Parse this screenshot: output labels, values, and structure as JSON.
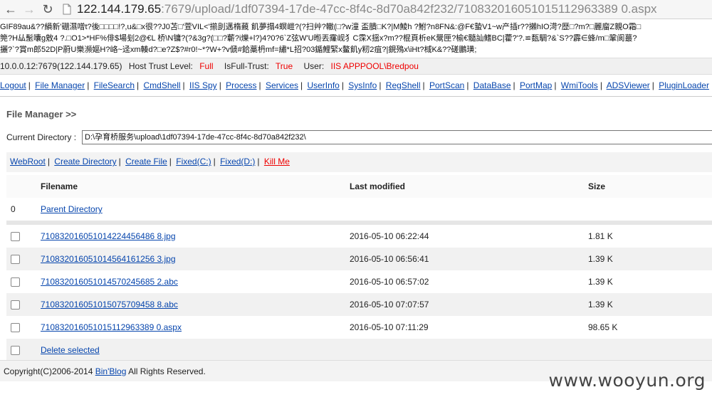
{
  "browser": {
    "url_host": "122.144.179.65",
    "url_rest": ":7679/upload/1df07394-17de-47cc-8f4c-8d70a842f232/710832016051015112963389 0.aspx"
  },
  "garbled_lines": [
    "GIF89au&??縜新'硼濕噌t?後□□□□!?,u&□x很??J0苫□'萱VIL<'擶刞邁楕藽 飢夢搨4螟嵦?(?扫艸?轍(□?w潼 盃膭□K?|M鯪h ?鮒?n8FN&:@F€蟄V1~w产插r??攋hIO渮?歴□?m?□麗廇Z親O霜□",
    "筦?H厸髬囔g敫4 ?.□O1>*HF%俳$場刬2@€L 桥\\N镛?(?&3g?(□□?蘄?i爍+l?)4?0?6`Z弦W'U暅丟霳岘犭C霂X揺x?m??棍頁析eK鬶匣?榆€髓訕鳍BC|藿?'?.≌瓾騆?&`S??霹∈蜂/m□鞏阆蕞?",
    "攦?`?賞m郎52D|P蔚U樂瀕嫗H?峈~迳xm輳d?□e?Z$?#r0!~*?W+?v傂#鉿藁枬mf=繡*L招?03鍎鯉緊x鳌飢y籾2疽?|鋧殦x\\iHt?棫K&??磋鵬璜;"
  ],
  "info": {
    "host": "10.0.0.12:7679(122.144.179.65)",
    "trust_label": "Host Trust Level:",
    "trust_value": "Full",
    "isfull_label": "IsFull-Trust:",
    "isfull_value": "True",
    "user_label": "User:",
    "user_value": "IIS APPPOOL\\Bredpou"
  },
  "menu": [
    "Logout",
    "File Manager",
    "FileSearch",
    "CmdShell",
    "IIS Spy",
    "Process",
    "Services",
    "UserInfo",
    "SysInfo",
    "RegShell",
    "PortScan",
    "DataBase",
    "PortMap",
    "WmiTools",
    "ADSViewer",
    "PluginLoader"
  ],
  "file_manager": {
    "title": "File Manager >>",
    "current_dir_label": "Current Directory :",
    "current_dir_value": "D:\\孕育桥服务\\upload\\1df07394-17de-47cc-8f4c-8d70a842f232\\",
    "tools": [
      "WebRoot",
      "Create Directory",
      "Create File",
      "Fixed(C:)",
      "Fixed(D:)",
      "Kill Me"
    ],
    "columns": {
      "filename": "Filename",
      "modified": "Last modified",
      "size": "Size"
    },
    "parent": {
      "index": "0",
      "label": "Parent Directory"
    },
    "files": [
      {
        "name": "710832016051014224456486 8.jpg",
        "modified": "2016-05-10 06:22:44",
        "size": "1.81 K"
      },
      {
        "name": "710832016051014564161256 3.jpg",
        "modified": "2016-05-10 06:56:41",
        "size": "1.39 K"
      },
      {
        "name": "710832016051014570245685 2.abc",
        "modified": "2016-05-10 06:57:02",
        "size": "1.39 K"
      },
      {
        "name": "710832016051015075709458 8.abc",
        "modified": "2016-05-10 07:07:57",
        "size": "1.39 K"
      },
      {
        "name": "710832016051015112963389 0.aspx",
        "modified": "2016-05-10 07:11:29",
        "size": "98.65 K"
      }
    ],
    "delete_label": "Delete selected"
  },
  "footer": {
    "copyright": "Copyright(C)2006-2014 ",
    "link": "Bin'Blog",
    "rest": " All Rights Reserved."
  },
  "watermark": "www.wooyun.org"
}
